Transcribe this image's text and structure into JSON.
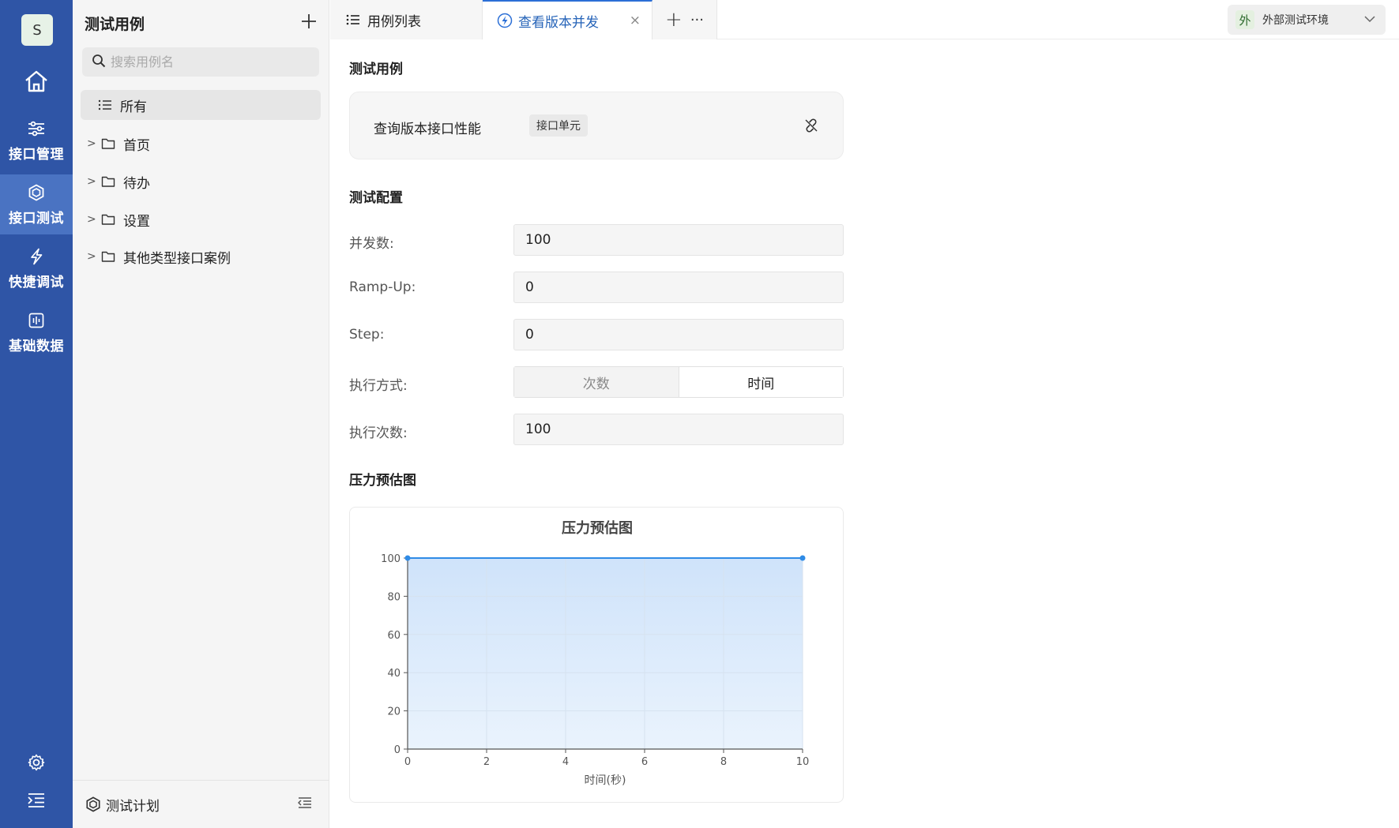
{
  "rail": {
    "avatar": "S",
    "items": [
      {
        "label": "接口管理"
      },
      {
        "label": "接口测试"
      },
      {
        "label": "快捷调试"
      },
      {
        "label": "基础数据"
      }
    ]
  },
  "tree": {
    "title": "测试用例",
    "search_placeholder": "搜索用例名",
    "all_label": "所有",
    "folders": [
      "首页",
      "待办",
      "设置",
      "其他类型接口案例"
    ],
    "footer_label": "测试计划"
  },
  "tabs": {
    "list_label": "用例列表",
    "active_label": "查看版本并发",
    "close": "×",
    "add": "+",
    "more": "···"
  },
  "env": {
    "badge": "外",
    "label": "外部测试环境"
  },
  "main": {
    "case_section": "测试用例",
    "case_name": "查询版本接口性能",
    "case_tag": "接口单元",
    "config_section": "测试配置",
    "fields": {
      "concurrency_label": "并发数:",
      "concurrency_value": "100",
      "rampup_label": "Ramp-Up:",
      "rampup_value": "0",
      "step_label": "Step:",
      "step_value": "0",
      "mode_label": "执行方式:",
      "mode_option_count": "次数",
      "mode_option_time": "时间",
      "count_label": "执行次数:",
      "count_value": "100"
    },
    "chart_section": "压力预估图"
  },
  "colors": {
    "rail_bg": "#2f55a6",
    "rail_active": "#4a73c2",
    "accent": "#2b6fd6",
    "series_line": "#2f8be6"
  },
  "chart_data": {
    "type": "area",
    "title": "压力预估图",
    "xlabel": "时间(秒)",
    "ylabel": "",
    "x": [
      0,
      10
    ],
    "series": [
      {
        "values": [
          100,
          100
        ]
      }
    ],
    "xlim": [
      0,
      10
    ],
    "ylim": [
      0,
      100
    ],
    "xticks": [
      "0",
      "2",
      "4",
      "6",
      "8",
      "10"
    ],
    "yticks": [
      "0",
      "20",
      "40",
      "60",
      "80",
      "100"
    ],
    "grid": true,
    "legend": "none"
  }
}
